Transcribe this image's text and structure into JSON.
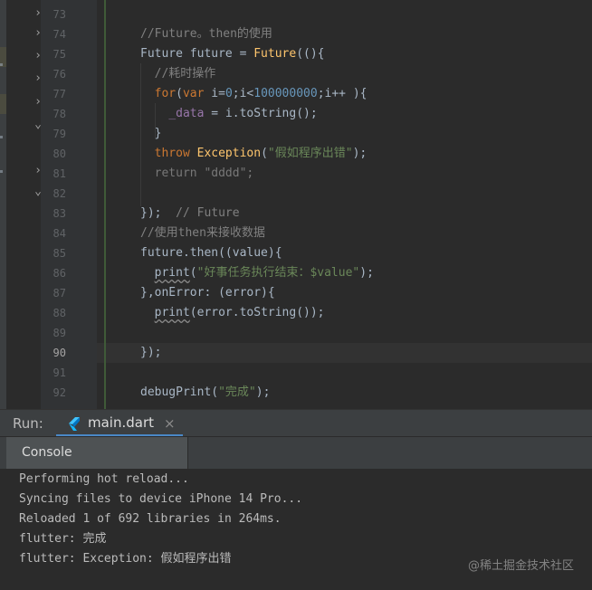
{
  "editor": {
    "caret_line_index": 17,
    "lines": [
      {
        "num": "73",
        "segments": []
      },
      {
        "num": "74",
        "segments": [
          {
            "t": "//Future。then的使用",
            "c": "cmt"
          }
        ]
      },
      {
        "num": "75",
        "segments": [
          {
            "t": "Future future = ",
            "c": ""
          },
          {
            "t": "Future",
            "c": "fn"
          },
          {
            "t": "((){",
            "c": ""
          }
        ]
      },
      {
        "num": "76",
        "segments": [
          {
            "t": "  //耗时操作",
            "c": "cmt"
          }
        ]
      },
      {
        "num": "77",
        "segments": [
          {
            "t": "  ",
            "c": ""
          },
          {
            "t": "for",
            "c": "kw"
          },
          {
            "t": "(",
            "c": ""
          },
          {
            "t": "var",
            "c": "kw"
          },
          {
            "t": " i=",
            "c": ""
          },
          {
            "t": "0",
            "c": "num"
          },
          {
            "t": ";i<",
            "c": ""
          },
          {
            "t": "100000000",
            "c": "num"
          },
          {
            "t": ";i++ ){",
            "c": ""
          }
        ]
      },
      {
        "num": "78",
        "segments": [
          {
            "t": "    ",
            "c": ""
          },
          {
            "t": "_data",
            "c": "fld"
          },
          {
            "t": " = i.toString();",
            "c": ""
          }
        ]
      },
      {
        "num": "79",
        "segments": [
          {
            "t": "  }",
            "c": ""
          }
        ]
      },
      {
        "num": "80",
        "segments": [
          {
            "t": "  ",
            "c": ""
          },
          {
            "t": "throw",
            "c": "kw"
          },
          {
            "t": " ",
            "c": ""
          },
          {
            "t": "Exception",
            "c": "fn"
          },
          {
            "t": "(",
            "c": ""
          },
          {
            "t": "\"假如程序出错\"",
            "c": "str"
          },
          {
            "t": ");",
            "c": ""
          }
        ]
      },
      {
        "num": "81",
        "segments": [
          {
            "t": "  return \"dddd\";",
            "c": "dim"
          }
        ]
      },
      {
        "num": "82",
        "segments": []
      },
      {
        "num": "83",
        "segments": [
          {
            "t": "});  ",
            "c": ""
          },
          {
            "t": "// Future",
            "c": "cmt"
          }
        ]
      },
      {
        "num": "84",
        "segments": [
          {
            "t": "//使用then来接收数据",
            "c": "cmt"
          }
        ]
      },
      {
        "num": "85",
        "segments": [
          {
            "t": "future.then((value){",
            "c": ""
          }
        ]
      },
      {
        "num": "86",
        "segments": [
          {
            "t": "  ",
            "c": ""
          },
          {
            "t": "print",
            "c": "wavy"
          },
          {
            "t": "(",
            "c": ""
          },
          {
            "t": "\"好事任务执行结束：$value\"",
            "c": "str"
          },
          {
            "t": ");",
            "c": ""
          }
        ]
      },
      {
        "num": "87",
        "segments": [
          {
            "t": "},onError: (error){",
            "c": ""
          }
        ]
      },
      {
        "num": "88",
        "segments": [
          {
            "t": "  ",
            "c": ""
          },
          {
            "t": "print",
            "c": "wavy"
          },
          {
            "t": "(error.toString());",
            "c": ""
          }
        ]
      },
      {
        "num": "89",
        "segments": []
      },
      {
        "num": "90",
        "segments": [
          {
            "t": "});",
            "c": ""
          }
        ]
      },
      {
        "num": "91",
        "segments": []
      },
      {
        "num": "92",
        "segments": [
          {
            "t": "debugPrint(",
            "c": ""
          },
          {
            "t": "\"完成\"",
            "c": "str"
          },
          {
            "t": ");",
            "c": ""
          }
        ]
      }
    ]
  },
  "run_panel": {
    "label": "Run:",
    "tab_title": "main.dart",
    "close_glyph": "×",
    "console_tab": "Console"
  },
  "console_output": [
    "Performing hot reload...",
    "Syncing files to device iPhone 14 Pro...",
    "Reloaded 1 of 692 libraries in 264ms.",
    "flutter: 完成",
    "flutter: Exception: 假如程序出错"
  ],
  "watermark": "@稀土掘金技术社区",
  "icons": {
    "collapse_arrow": "chevron-right-icon",
    "expand_arrow": "chevron-down-icon",
    "dart_logo": "dart-icon"
  },
  "colors": {
    "editor_bg": "#2b2b2b",
    "keyword": "#cc7832",
    "string": "#6a8759",
    "number": "#6897bb",
    "comment": "#808080",
    "function": "#ffc66d",
    "accent": "#4a88c7"
  }
}
